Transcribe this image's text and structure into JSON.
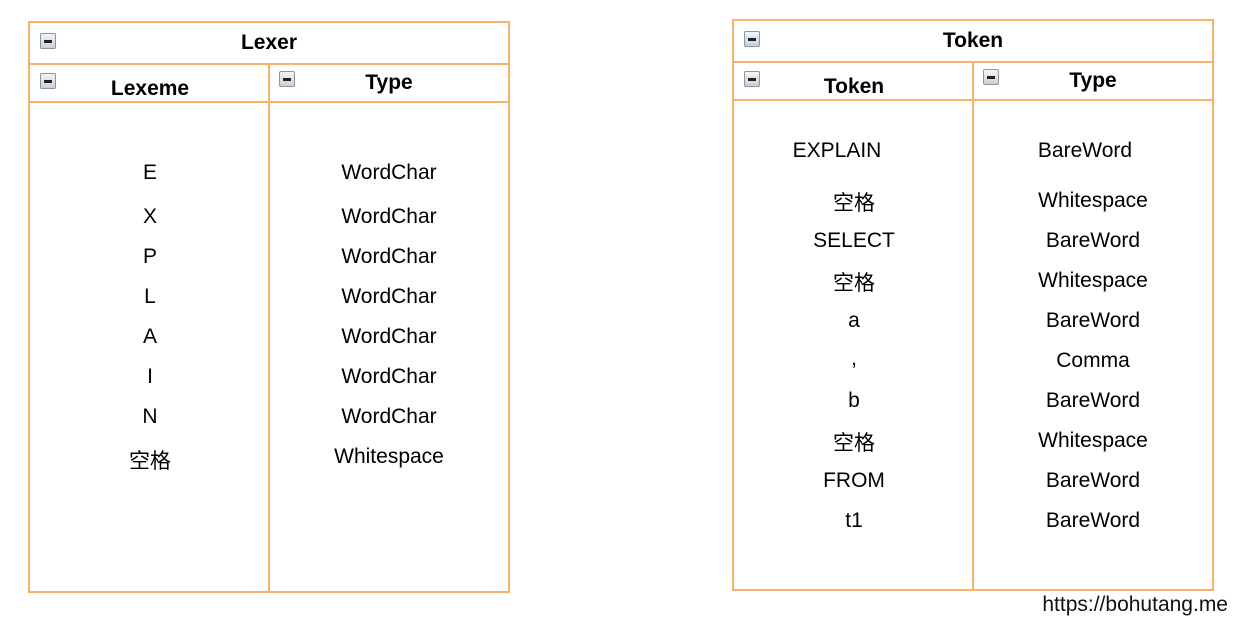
{
  "lexer": {
    "title": "Lexer",
    "columns": [
      {
        "header": "Lexeme",
        "cells": [
          "E",
          "X",
          "P",
          "L",
          "A",
          "I",
          "N",
          "空格"
        ]
      },
      {
        "header": "Type",
        "cells": [
          "WordChar",
          "WordChar",
          "WordChar",
          "WordChar",
          "WordChar",
          "WordChar",
          "WordChar",
          "Whitespace"
        ]
      }
    ]
  },
  "token": {
    "title": "Token",
    "columns": [
      {
        "header": "Token",
        "cells": [
          "EXPLAIN",
          "空格",
          "SELECT",
          "空格",
          "a",
          ",",
          "b",
          "空格",
          "FROM",
          "t1"
        ]
      },
      {
        "header": "Type",
        "cells": [
          "BareWord",
          "Whitespace",
          "BareWord",
          "Whitespace",
          "BareWord",
          "Comma",
          "BareWord",
          "Whitespace",
          "BareWord",
          "BareWord"
        ]
      }
    ]
  },
  "credit": "https://bohutang.me",
  "colors": {
    "border": "#f8b26a"
  }
}
